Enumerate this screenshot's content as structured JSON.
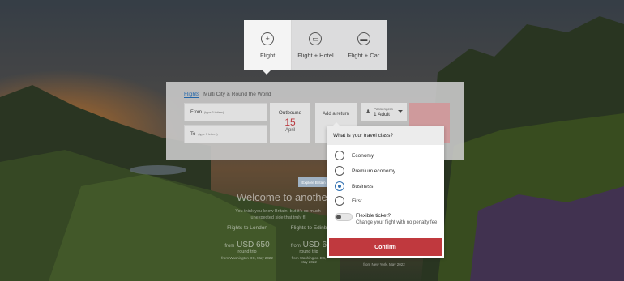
{
  "products": [
    {
      "label": "Flight",
      "icon": "plus-icon",
      "glyph": "+"
    },
    {
      "label": "Flight + Hotel",
      "icon": "bed-icon",
      "glyph": "▭"
    },
    {
      "label": "Flight + Car",
      "icon": "car-icon",
      "glyph": "▬"
    }
  ],
  "trip_tabs": [
    "Flights",
    "Multi City & Round the World"
  ],
  "search": {
    "from_label": "From",
    "from_hint": "(type 3 letters)",
    "to_label": "To",
    "to_hint": "(type 3 letters)",
    "outbound_label": "Outbound",
    "outbound_day": "15",
    "outbound_month": "April",
    "add_return": "Add a return",
    "passengers_label": "Passengers",
    "passengers_value": "1 Adult"
  },
  "welcome": {
    "explore": "Explore Britain",
    "headline": "Welcome to another",
    "intro_line1": "You think you know Britain, but it's so much",
    "intro_line2": "unexpected side that truly fl"
  },
  "deals": [
    {
      "title": "Flights to London",
      "price_prefix": "from",
      "price": "USD 650",
      "sub": "round trip",
      "origin": "from Washington DC, May 2022"
    },
    {
      "title": "Flights to Edinb",
      "price_prefix": "from",
      "price": "USD 6",
      "sub": "round trip",
      "origin": "from Washington DC, May 2022"
    },
    {
      "title": "",
      "price_prefix": "",
      "price": "",
      "sub": "",
      "origin": "from New York, May 2022"
    }
  ],
  "class_dropdown": {
    "question": "What is your travel class?",
    "options": [
      {
        "label": "Economy",
        "checked": false
      },
      {
        "label": "Premium economy",
        "checked": false
      },
      {
        "label": "Business",
        "checked": true
      },
      {
        "label": "First",
        "checked": false
      }
    ],
    "flexible_title": "Flexible ticket?",
    "flexible_desc": "Change your flight with no penalty fee",
    "confirm": "Confirm"
  },
  "colors": {
    "accent_red": "#c0393e",
    "selected_blue": "#2f6fb0"
  }
}
